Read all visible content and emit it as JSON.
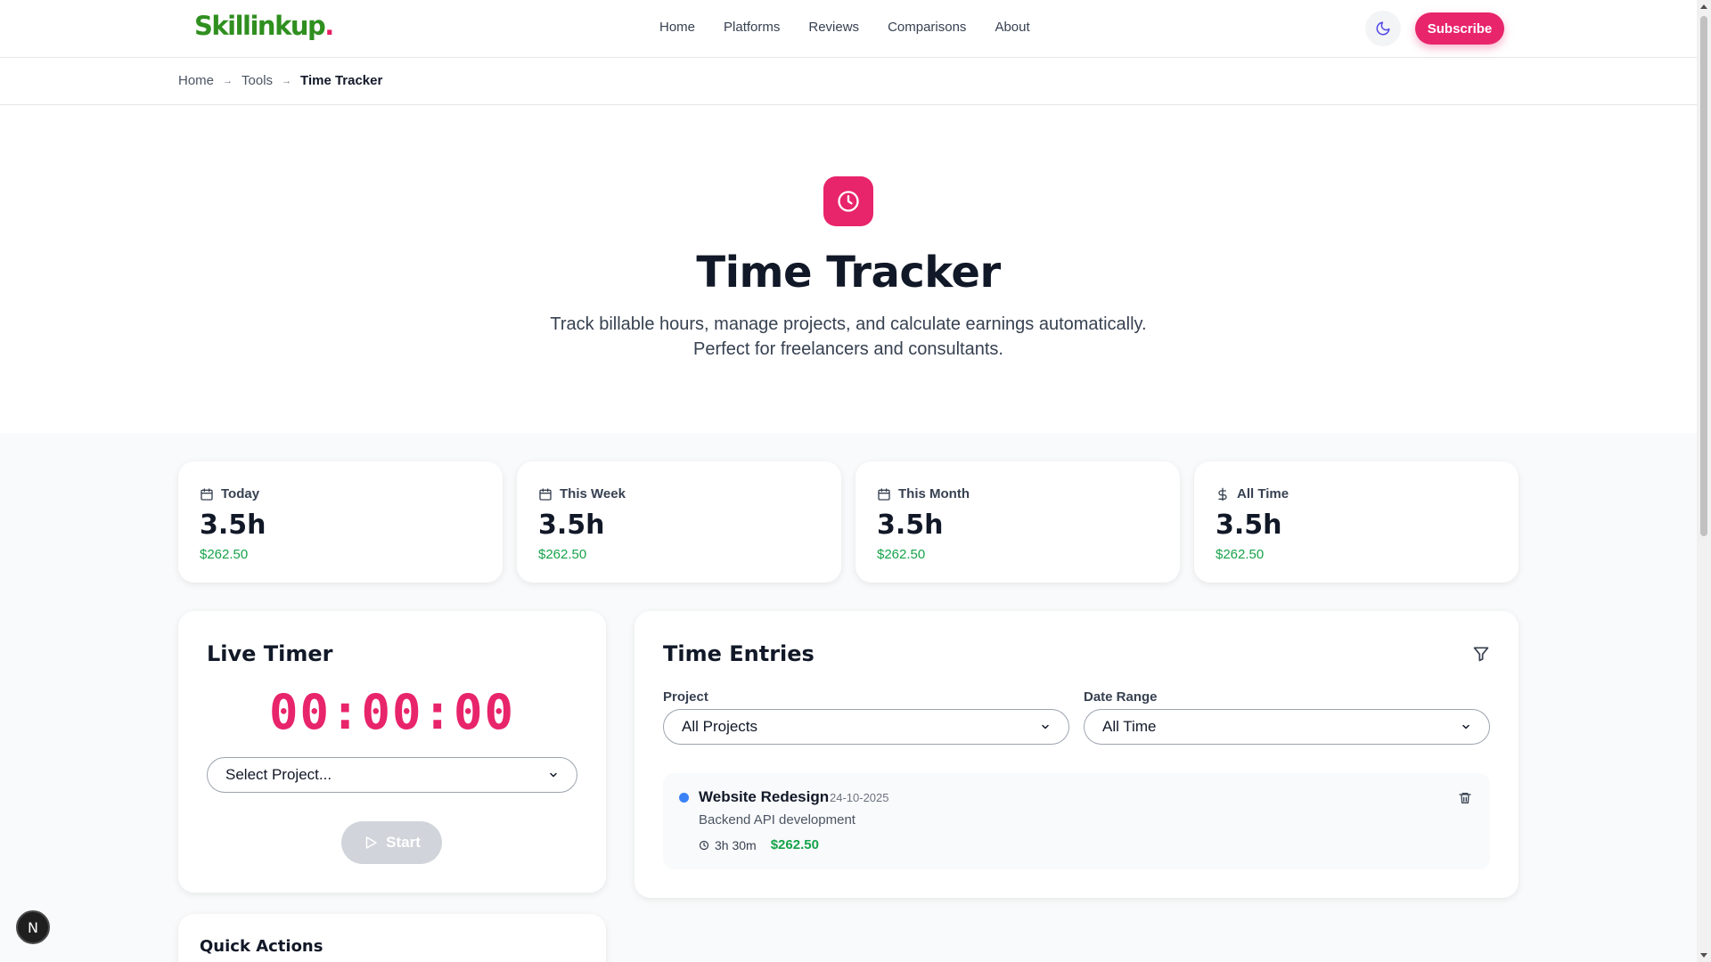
{
  "header": {
    "logo_text": "Skillinkup",
    "logo_dot": ".",
    "nav": [
      "Home",
      "Platforms",
      "Reviews",
      "Comparisons",
      "About"
    ],
    "theme_icon": "moon-icon",
    "subscribe_label": "Subscribe"
  },
  "breadcrumb": {
    "items": [
      "Home",
      "Tools"
    ],
    "separator": "→",
    "current": "Time Tracker"
  },
  "hero": {
    "icon": "clock-icon",
    "title": "Time Tracker",
    "subtitle_line1": "Track billable hours, manage projects, and calculate earnings automatically.",
    "subtitle_line2": "Perfect for freelancers and consultants."
  },
  "stats": [
    {
      "label": "Today",
      "icon": "calendar-icon",
      "hours": "3.5h",
      "earnings": "$262.50"
    },
    {
      "label": "This Week",
      "icon": "calendar-icon",
      "hours": "3.5h",
      "earnings": "$262.50"
    },
    {
      "label": "This Month",
      "icon": "calendar-icon",
      "hours": "3.5h",
      "earnings": "$262.50"
    },
    {
      "label": "All Time",
      "icon": "dollar-icon",
      "hours": "3.5h",
      "earnings": "$262.50"
    }
  ],
  "timer": {
    "title": "Live Timer",
    "display": "00:00:00",
    "project_select": "Select Project...",
    "start_label": "Start"
  },
  "entries": {
    "title": "Time Entries",
    "filter_icon": "filter-icon",
    "project_label": "Project",
    "project_value": "All Projects",
    "date_label": "Date Range",
    "date_value": "All Time",
    "items": [
      {
        "name": "Website Redesign",
        "date": "24-10-2025",
        "description": "Backend API development",
        "duration": "3h 30m",
        "earnings": "$262.50",
        "color": "#3b82f6"
      }
    ]
  },
  "quick_actions": {
    "title": "Quick Actions"
  },
  "floating_badge": "N",
  "colors": {
    "accent": "#e8246b",
    "brand_green": "#2f8f1f",
    "money_green": "#16a34a"
  }
}
